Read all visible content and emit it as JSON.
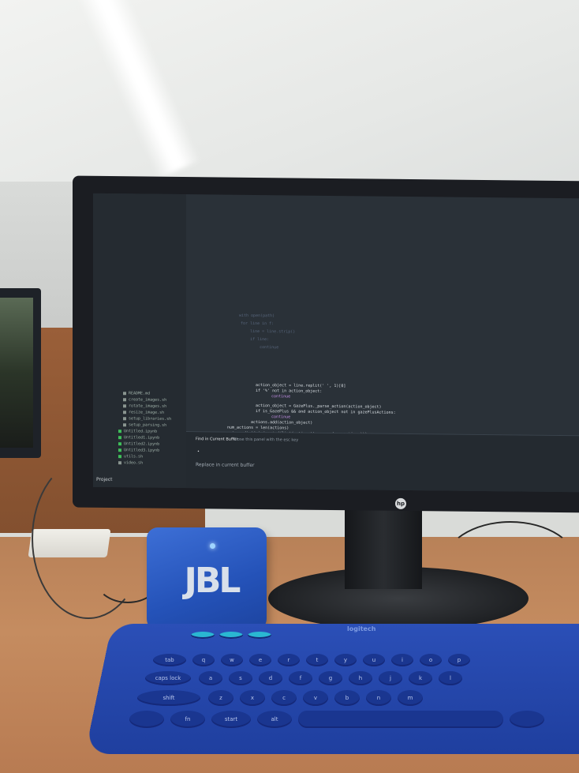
{
  "scene": {
    "description_colors": {
      "wall": "#e6e8e6",
      "desk": "#c58c60",
      "speaker": "#2452b8",
      "keyboard": "#1f3f9f",
      "monitor": "#1b1d22"
    }
  },
  "monitor": {
    "brand": "hp",
    "sidebar": {
      "items": [
        "README.md",
        "create_images.sh",
        "rotate_images.sh",
        "resize_image.sh",
        "setup_libraries.sh",
        "setup_parsing.sh",
        "Untitled.ipynb",
        "Untitled1.ipynb",
        "Untitled2.ipynb",
        "Untitled3.ipynb",
        "utils.sh",
        "video.sh"
      ],
      "project_label": "Project"
    },
    "code": [
      "action_object = line.replit(' ', 1)[0]",
      "if '%' not in action_object:",
      "    continue",
      "action_object = GazePlus._parse_action(action_object)",
      "if is_GazePlus && and action_object not in gazePlusActions:",
      "    continue",
      "actions.add(action_object)",
      "num_actions = len(actions)",
      "return dict(zip(sorted(list(actions)), range(num_actions)))"
    ],
    "find_panel": {
      "title": "Find in Current Buffer",
      "hint": "Close this panel with the esc key",
      "caret": "•",
      "replace_placeholder": "Replace in current buffer"
    }
  },
  "speaker": {
    "logo": "JBL"
  },
  "keyboard": {
    "brand": "logitech",
    "keys": {
      "tab": "tab",
      "caps": "caps lock",
      "shift": "shift",
      "fn": "fn",
      "start": "start",
      "alt": "alt",
      "row1": [
        "q",
        "w",
        "e",
        "r",
        "t",
        "y",
        "u",
        "i",
        "o",
        "p"
      ],
      "row2": [
        "a",
        "s",
        "d",
        "f",
        "g",
        "h",
        "j",
        "k",
        "l"
      ],
      "row3": [
        "z",
        "x",
        "c",
        "v",
        "b",
        "n",
        "m"
      ]
    }
  }
}
